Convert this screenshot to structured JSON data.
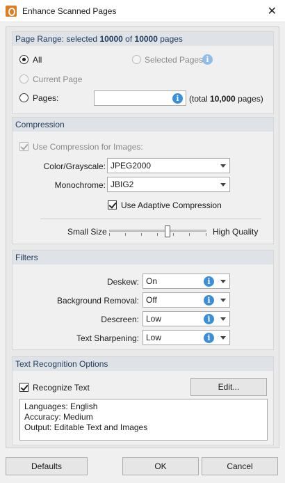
{
  "window": {
    "title": "Enhance Scanned Pages"
  },
  "page_range": {
    "heading_prefix": "Page Range: selected",
    "selected_count": "10000",
    "heading_of": "of",
    "total_count": "10000",
    "heading_suffix": "pages",
    "all_label": "All",
    "selected_pages_label": "Selected Pages",
    "current_page_label": "Current Page",
    "pages_label": "Pages:",
    "pages_input_value": "",
    "total_prefix": "(total",
    "total_value": "10,000",
    "total_suffix": "pages)"
  },
  "compression": {
    "heading": "Compression",
    "use_compression_label": "Use Compression for Images:",
    "color_label": "Color/Grayscale:",
    "color_value": "JPEG2000",
    "mono_label": "Monochrome:",
    "mono_value": "JBIG2",
    "adaptive_label": "Use Adaptive Compression",
    "small_size_label": "Small Size",
    "high_quality_label": "High Quality",
    "quality_level": 0.6
  },
  "filters": {
    "heading": "Filters",
    "items": [
      {
        "label": "Deskew:",
        "value": "On"
      },
      {
        "label": "Background Removal:",
        "value": "Off"
      },
      {
        "label": "Descreen:",
        "value": "Low"
      },
      {
        "label": "Text Sharpening:",
        "value": "Low"
      }
    ]
  },
  "ocr": {
    "heading": "Text Recognition Options",
    "recognize_label": "Recognize Text",
    "edit_label": "Edit...",
    "info_lines": [
      "Languages: English",
      "Accuracy: Medium",
      "Output: Editable Text and Images"
    ]
  },
  "footer": {
    "defaults_label": "Defaults",
    "ok_label": "OK",
    "cancel_label": "Cancel"
  }
}
